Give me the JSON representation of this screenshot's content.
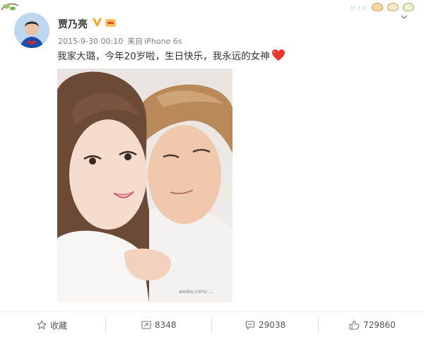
{
  "post": {
    "author": "贾乃亮",
    "time": "2015-9-30 00:10",
    "source_prefix": "来自",
    "source": "iPhone 6s",
    "text": "我家大璐，今年20岁啦，生日快乐，我永远的女神",
    "watermark": "weibo.com/ ..."
  },
  "actions": {
    "favorite": "收藏",
    "forward_count": "8348",
    "comment_count": "29038",
    "like_count": "729860"
  },
  "icons": {
    "verified": "verified-v-icon",
    "vip": "vip-crown-icon",
    "heart": "heart-emoji-icon",
    "favorite": "star-icon",
    "forward": "forward-icon",
    "comment": "comment-icon",
    "like": "thumbs-up-icon",
    "menu": "chevron-down-icon"
  },
  "colors": {
    "verified": "#f5a623",
    "heart": "#e8372c",
    "text": "#333333",
    "meta": "#808080"
  }
}
